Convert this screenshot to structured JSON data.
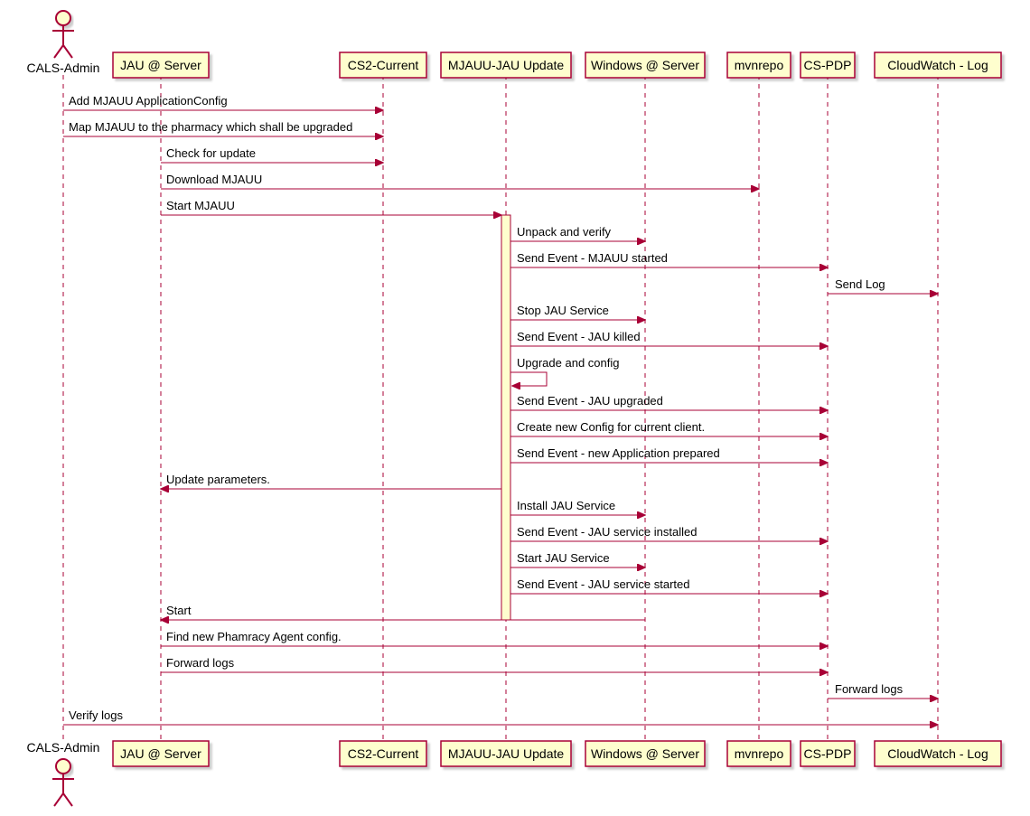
{
  "participants": {
    "actor": "CALS-Admin",
    "p1": "JAU @ Server",
    "p2": "CS2-Current",
    "p3": "MJAUU-JAU Update",
    "p4": "Windows @ Server",
    "p5": "mvnrepo",
    "p6": "CS-PDP",
    "p7": "CloudWatch - Log"
  },
  "messages": {
    "m1": "Add MJAUU ApplicationConfig",
    "m2": "Map MJAUU to the pharmacy which shall be upgraded",
    "m3": "Check for update",
    "m4": "Download MJAUU",
    "m5": "Start MJAUU",
    "m6": "Unpack and verify",
    "m7": "Send Event - MJAUU started",
    "m8": "Send Log",
    "m9": "Stop JAU Service",
    "m10": "Send Event - JAU killed",
    "m11": "Upgrade and config",
    "m12": "Send Event - JAU upgraded",
    "m13": "Create new Config for current client.",
    "m14": "Send Event - new Application prepared",
    "m15": "Update parameters.",
    "m16": "Install JAU Service",
    "m17": "Send Event - JAU service installed",
    "m18": "Start JAU Service",
    "m19": "Send Event - JAU service started",
    "m20": "Start",
    "m21": "Find new Phamracy Agent config.",
    "m22": "Forward logs",
    "m23": "Forward logs",
    "m24": "Verify logs"
  }
}
